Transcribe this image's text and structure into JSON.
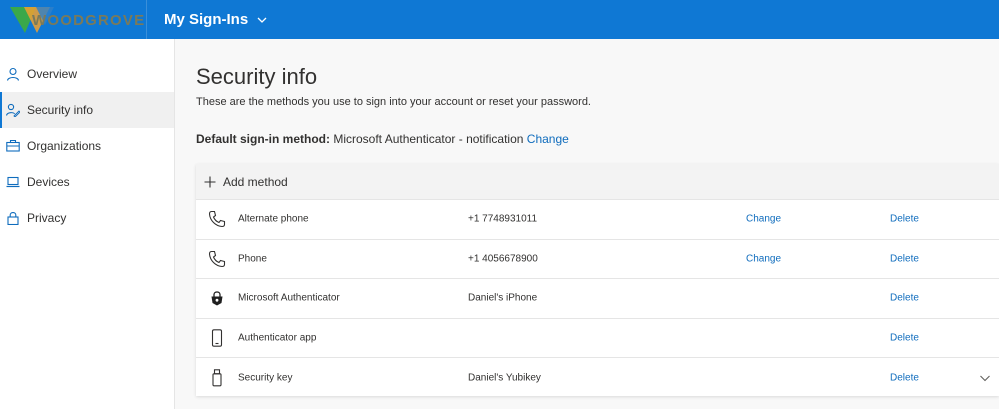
{
  "brand": {
    "logo_text": "WOODGROVE",
    "accent_color": "#0f78d4"
  },
  "header": {
    "app_title": "My Sign-Ins",
    "switch_icon": "chevron-down-icon"
  },
  "sidebar": {
    "items": [
      {
        "label": "Overview",
        "icon": "person-icon",
        "active": false
      },
      {
        "label": "Security info",
        "icon": "security-info-icon",
        "active": true
      },
      {
        "label": "Organizations",
        "icon": "briefcase-icon",
        "active": false
      },
      {
        "label": "Devices",
        "icon": "laptop-icon",
        "active": false
      },
      {
        "label": "Privacy",
        "icon": "lock-icon",
        "active": false
      }
    ]
  },
  "main": {
    "title": "Security info",
    "subtitle": "These are the methods you use to sign into your account or reset your password.",
    "default_method": {
      "label": "Default sign-in method:",
      "value": "Microsoft Authenticator - notification",
      "change_label": "Change"
    },
    "add_method_label": "Add method",
    "methods": [
      {
        "icon": "phone-icon",
        "name": "Alternate phone",
        "detail": "+1 7748931011",
        "change": "Change",
        "delete": "Delete"
      },
      {
        "icon": "phone-icon",
        "name": "Phone",
        "detail": "+1 4056678900",
        "change": "Change",
        "delete": "Delete"
      },
      {
        "icon": "authenticator-lock-icon",
        "name": "Microsoft Authenticator",
        "detail": "Daniel's iPhone",
        "change": "",
        "delete": "Delete"
      },
      {
        "icon": "mobile-device-icon",
        "name": "Authenticator app",
        "detail": "",
        "change": "",
        "delete": "Delete"
      },
      {
        "icon": "usb-key-icon",
        "name": "Security key",
        "detail": "Daniel's Yubikey",
        "change": "",
        "delete": "Delete",
        "expand_icon": "chevron-down-icon"
      }
    ]
  }
}
